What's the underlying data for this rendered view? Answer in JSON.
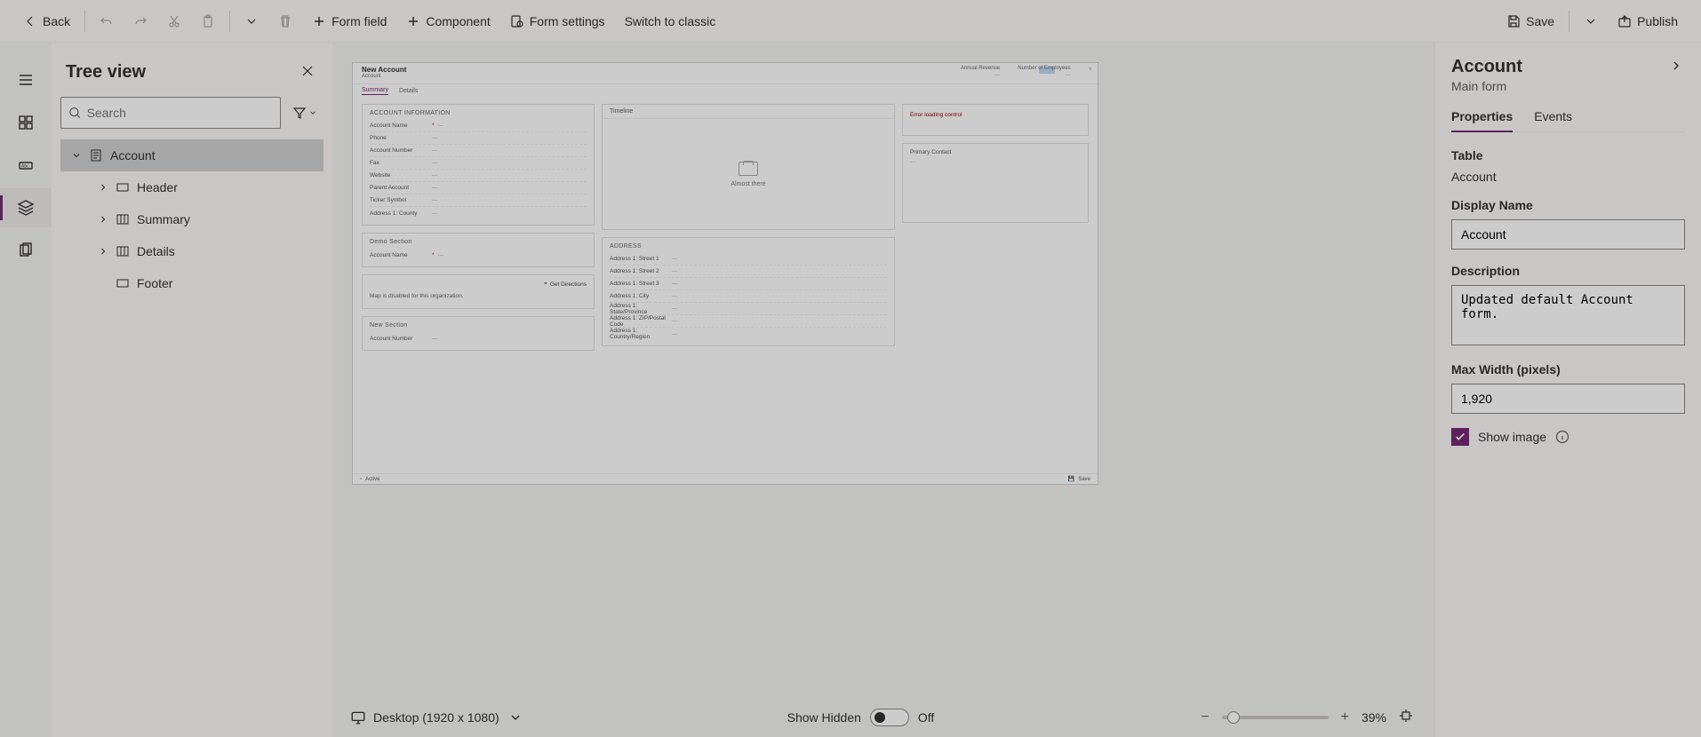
{
  "toolbar": {
    "back": "Back",
    "formfield": "Form field",
    "component": "Component",
    "formsettings": "Form settings",
    "switchclassic": "Switch to classic",
    "save": "Save",
    "publish": "Publish"
  },
  "tree": {
    "title": "Tree view",
    "searchPlaceholder": "Search",
    "root": "Account",
    "items": [
      {
        "label": "Header"
      },
      {
        "label": "Summary"
      },
      {
        "label": "Details"
      },
      {
        "label": "Footer"
      }
    ]
  },
  "preview": {
    "title": "New Account",
    "subtitle": "Account",
    "headerFields": [
      {
        "label": "Annual Revenue",
        "value": "---"
      },
      {
        "label": "Number of Employees",
        "value": "---"
      }
    ],
    "tabs": [
      "Summary",
      "Details"
    ],
    "sections": {
      "accountInfo": {
        "title": "ACCOUNT INFORMATION",
        "fields": [
          {
            "label": "Account Name",
            "star": true,
            "value": "---"
          },
          {
            "label": "Phone",
            "value": "---"
          },
          {
            "label": "Account Number",
            "value": "---"
          },
          {
            "label": "Fax",
            "value": "---"
          },
          {
            "label": "Website",
            "value": "---"
          },
          {
            "label": "Parent Account",
            "value": "---"
          },
          {
            "label": "Ticker Symbol",
            "value": "---"
          },
          {
            "label": "Address 1: County",
            "value": "---"
          }
        ]
      },
      "demo": {
        "title": "Demo Section",
        "fields": [
          {
            "label": "Account Name",
            "star": true,
            "value": "---"
          }
        ]
      },
      "map": {
        "getDirections": "Get Directions",
        "disabled": "Map is disabled for this organization."
      },
      "newSection": {
        "title": "New Section",
        "fields": [
          {
            "label": "Account Number",
            "value": "---"
          }
        ]
      },
      "timeline": {
        "title": "Timeline",
        "text": "Almost there"
      },
      "address": {
        "title": "ADDRESS",
        "fields": [
          {
            "label": "Address 1: Street 1",
            "value": "---"
          },
          {
            "label": "Address 1: Street 2",
            "value": "---"
          },
          {
            "label": "Address 1: Street 3",
            "value": "---"
          },
          {
            "label": "Address 1: City",
            "value": "---"
          },
          {
            "label": "Address 1: State/Province",
            "value": "---"
          },
          {
            "label": "Address 1: ZIP/Postal Code",
            "value": "---"
          },
          {
            "label": "Address 1: Country/Region",
            "value": "---"
          }
        ]
      },
      "error": "Error loading control",
      "primaryContact": {
        "title": "Primary Contact",
        "value": "---"
      }
    },
    "statusbar": {
      "left": "Active",
      "right": "Save"
    }
  },
  "canvasStatus": {
    "device": "Desktop (1920 x 1080)",
    "showHidden": "Show Hidden",
    "toggleState": "Off",
    "zoom": "39%"
  },
  "props": {
    "title": "Account",
    "subtitle": "Main form",
    "tabs": [
      "Properties",
      "Events"
    ],
    "tableLabel": "Table",
    "tableValue": "Account",
    "displayNameLabel": "Display Name",
    "displayNameValue": "Account",
    "descLabel": "Description",
    "descValue": "Updated default Account form.",
    "maxWidthLabel": "Max Width (pixels)",
    "maxWidthValue": "1,920",
    "showImage": "Show image"
  }
}
